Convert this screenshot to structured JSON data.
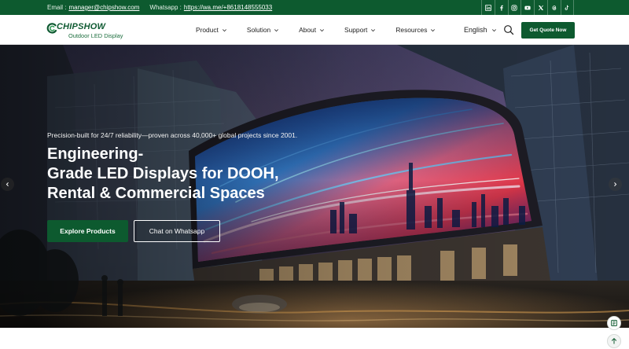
{
  "topbar": {
    "email_label": "Email :",
    "email": "manager@chipshow.com",
    "whatsapp_label": "Whatsapp :",
    "whatsapp": "https://wa.me/+8618148555033",
    "socials": [
      "linkedin-icon",
      "facebook-icon",
      "instagram-icon",
      "youtube-icon",
      "x-icon",
      "threads-icon",
      "tiktok-icon"
    ]
  },
  "header": {
    "brand": "CHIPSHOW",
    "tagline": "Outdoor LED Display",
    "nav": [
      {
        "label": "Product"
      },
      {
        "label": "Solution"
      },
      {
        "label": "About"
      },
      {
        "label": "Support"
      },
      {
        "label": "Resources"
      }
    ],
    "language": "English",
    "cta_label": "Get Quote Now"
  },
  "hero": {
    "subtitle": "Precision-built for 24/7 reliability—proven across 40,000+ global projects since 2001.",
    "title_lines": [
      "Engineering-",
      "Grade LED Displays for DOOH,",
      "Rental & Commercial Spaces"
    ],
    "primary_cta": "Explore Products",
    "secondary_cta": "Chat on Whatsapp"
  },
  "colors": {
    "brand_green": "#0d5a2f",
    "topbar_bg": "#0d5a2f"
  }
}
